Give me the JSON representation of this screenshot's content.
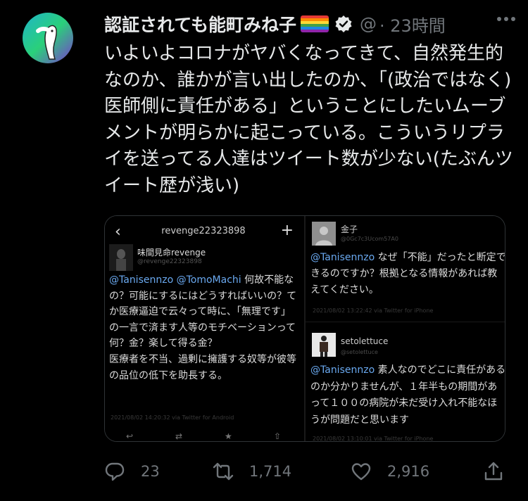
{
  "tweet": {
    "display_name": "認証されても能町みね子",
    "handle": "@",
    "time": "· 23時間",
    "body": "いよいよコロナがヤバくなってきて、自然発生的なのか、誰かが言い出したのか、「(政治ではなく)医師側に責任がある」ということにしたいムーブメントが明らかに起こっている。こういうリプライを送ってる人達はツイート数が少ない(たぶんツイート歴が浅い)",
    "icons": {
      "avatar": "avatar-illustration-icon",
      "flag": "rainbow-flag-icon",
      "verified": "verified-badge-icon",
      "more": "more-icon"
    }
  },
  "media": {
    "left": {
      "title": "revenge22323898",
      "author_name": "味間見命revenge",
      "author_handle": "@revenge22323898",
      "mention1": "@Tanisennzo",
      "mention2": "@TomoMachi",
      "text": " 何故不能なの？可能にするにはどうすればいいの？てか医療逼迫で云々って時に、「無理です」の一言で済ます人等のモチベーションって何？金？楽して得る金？\n医療者を不当、過剰に擁護する奴等が彼等の品位の低下を助長する。",
      "timestamp": "2021/08/02 14:20:32 via Twitter for Android"
    },
    "right": {
      "reply1_name": "金子",
      "reply1_handle": "@0Gc7c3Ucom57A0",
      "reply1_mention": "@Tanisennzo",
      "reply1_text": " なぜ「不能」だったと断定できるのですか？根拠となる情報があれば教えてください。",
      "reply1_time": "2021/08/02 13:22:42 via Twitter for iPhone",
      "reply2_name": "setolettuce",
      "reply2_handle": "@setolettuce",
      "reply2_mention": "@Tanisennzo",
      "reply2_text": " 素人なのでどこに責任があるのか分かりませんが、１年半もの期間があって１００の病院が未だ受け入れ不能なほうが問題だと思います",
      "reply2_time": "2021/08/02 13:10:01 via Twitter for iPhone"
    }
  },
  "actions": {
    "reply_count": "23",
    "retweet_count": "1,714",
    "like_count": "2,916"
  },
  "colors": {
    "background": "#000000",
    "text": "#e7e9ea",
    "secondary": "#71767b",
    "link": "#6aa9f0"
  }
}
